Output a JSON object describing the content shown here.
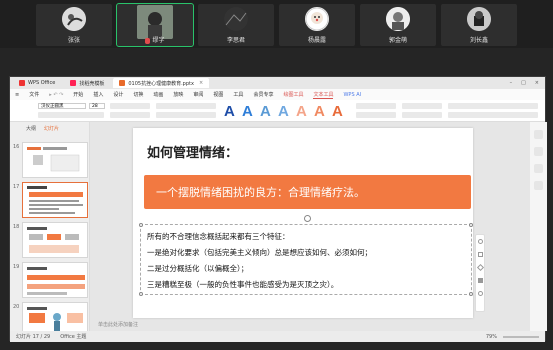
{
  "participants": [
    {
      "name": "张张",
      "muted": false
    },
    {
      "name": "缪字",
      "muted": true
    },
    {
      "name": "李思君",
      "muted": false
    },
    {
      "name": "杨晨露",
      "muted": false
    },
    {
      "name": "郭金萌",
      "muted": false
    },
    {
      "name": "刘长鑫",
      "muted": false
    }
  ],
  "wps": {
    "tabs": [
      "WPS Office",
      "找稻壳模板",
      "0105抗挫心理健康教育.pptx"
    ],
    "menu": [
      "文件",
      "开始",
      "插入",
      "设计",
      "切换",
      "动画",
      "放映",
      "审阅",
      "视图",
      "工具",
      "会员专享",
      "绘图工具",
      "文本工具",
      "WPS AI"
    ],
    "menu_selected": "文本工具",
    "font_name": "汉仪正圆黑",
    "font_size": "28",
    "left_tabs": [
      "大纲",
      "幻灯片"
    ],
    "slide_numbers": [
      "16",
      "17",
      "18",
      "19",
      "20"
    ],
    "status": {
      "slide": "幻灯片 17 / 29",
      "theme": "Office 主题",
      "notes_placeholder": "单击此处添加备注",
      "zoom": "79%"
    },
    "right_labels": [
      "形状填充",
      "形状轮廓",
      "形状效果",
      "排列",
      "旋转",
      "选择窗格",
      "转换"
    ]
  },
  "slide": {
    "title": "如何管理情绪：",
    "banner": "一个摆脱情绪困扰的良方：合理情绪疗法。",
    "lines": [
      "所有的不合理信念概括起来都有三个特征：",
      "一是绝对化要求（包括完美主义倾向）总是想应该如何、必须如何；",
      "二是过分概括化（以偏概全）；",
      "三是糟糕至极（一般的负性事件也能感受为是灭顶之灾）。"
    ]
  },
  "colors": {
    "banner": "#f27941",
    "accent": "#d9534f",
    "active_speaker": "#29c36a"
  }
}
